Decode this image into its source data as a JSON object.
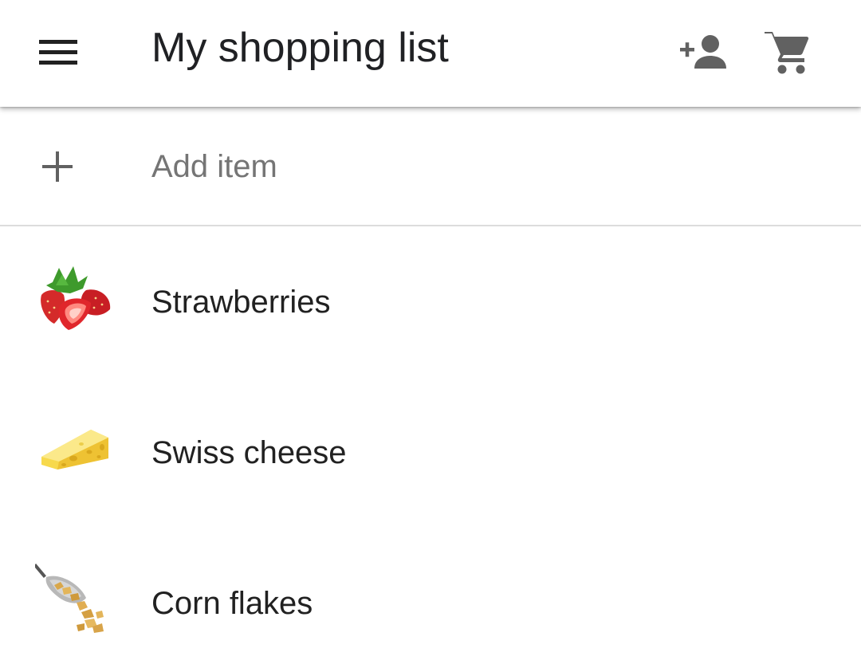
{
  "app_bar": {
    "title": "My shopping list",
    "menu_icon": "menu-icon",
    "actions": [
      {
        "icon": "add-person-icon"
      },
      {
        "icon": "shopping-cart-icon"
      }
    ],
    "icon_color": "#616161"
  },
  "add_item": {
    "icon": "plus-icon",
    "placeholder": "Add item"
  },
  "items": [
    {
      "name": "Strawberries",
      "image": "strawberries-image"
    },
    {
      "name": "Swiss cheese",
      "image": "swiss-cheese-image"
    },
    {
      "name": "Corn flakes",
      "image": "corn-flakes-image"
    }
  ]
}
